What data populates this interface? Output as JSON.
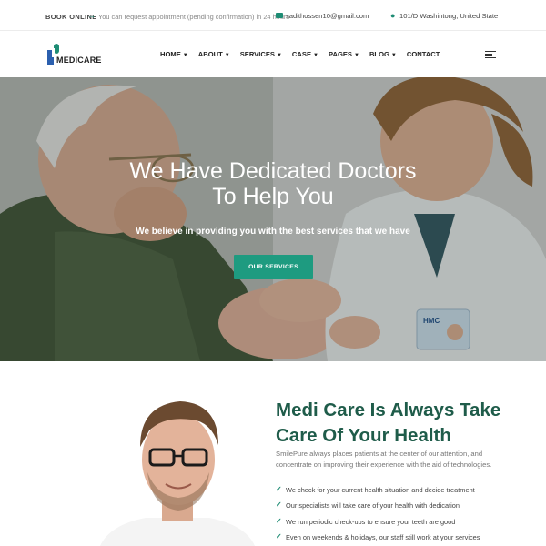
{
  "topbar": {
    "book_label": "BOOK ONLINE",
    "note": "You can request appointment (pending confirmation) in 24 hours",
    "email": "sadithossen10@gmail.com",
    "location": "101/D Washintong, United State"
  },
  "header": {
    "logo_text": "MEDICARE",
    "nav": [
      {
        "label": "HOME",
        "has_dropdown": true
      },
      {
        "label": "ABOUT",
        "has_dropdown": true
      },
      {
        "label": "SERVICES",
        "has_dropdown": true
      },
      {
        "label": "CASE",
        "has_dropdown": true
      },
      {
        "label": "PAGES",
        "has_dropdown": true
      },
      {
        "label": "BLOG",
        "has_dropdown": true
      },
      {
        "label": "CONTACT",
        "has_dropdown": false
      }
    ],
    "menu_icon": "hamburger-icon"
  },
  "hero": {
    "title_line1": "We Have Dedicated Doctors",
    "title_line2": "To Help You",
    "subtitle": "We believe in providing you with the best services that we have",
    "button_label": "OUR SERVICES",
    "badge_text": "HMC"
  },
  "about": {
    "title": "Medi Care Is Always Take Care Of Your Health",
    "text": "SmilePure always places patients at the center of our attention, and concentrate on improving their experience with the aid of technologies.",
    "checks": [
      "We check for your current health situation and decide treatment",
      "Our specialists will take care of your health with dedication",
      "We run periodic check-ups to ensure your teeth are good",
      "Even on weekends & holidays, our staff still work at your services"
    ]
  },
  "colors": {
    "accent": "#1e9b80",
    "heading": "#1f5c4a",
    "logo_blue": "#2b5fae"
  }
}
